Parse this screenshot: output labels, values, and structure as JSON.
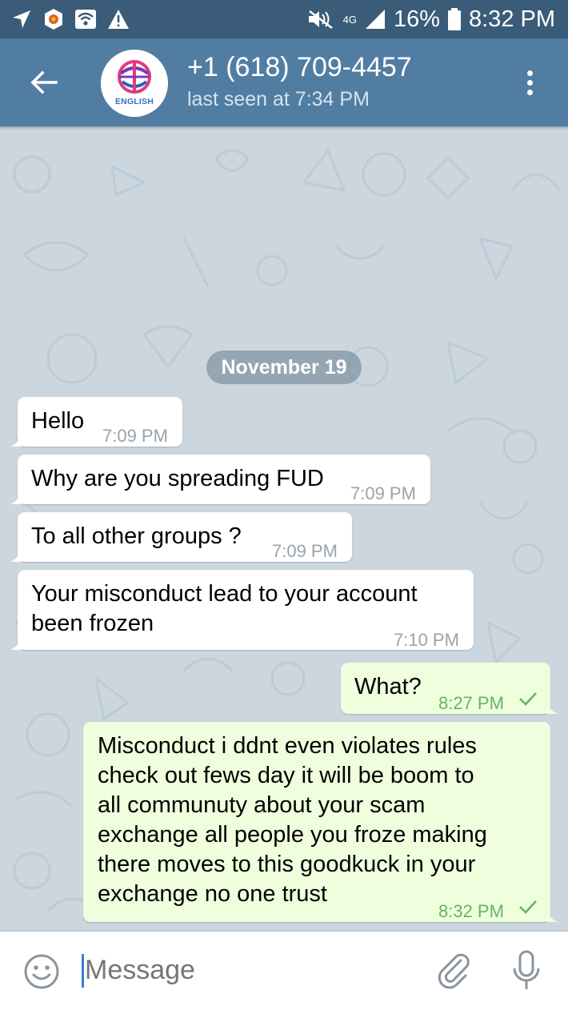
{
  "status_bar": {
    "network_label": "4G",
    "battery": "16%",
    "time": "8:32 PM"
  },
  "header": {
    "avatar_label": "ENGLISH",
    "title": "+1 (618) 709-4457",
    "subtitle": "last seen at 7:34 PM"
  },
  "chat": {
    "date": "November 19",
    "messages": [
      {
        "direction": "in",
        "text": "Hello",
        "time": "7:09 PM"
      },
      {
        "direction": "in",
        "text": "Why are you spreading FUD",
        "time": "7:09 PM"
      },
      {
        "direction": "in",
        "text": "To all other groups ?",
        "time": "7:09 PM"
      },
      {
        "direction": "in",
        "text": "Your misconduct lead to your account\nbeen frozen",
        "time": "7:10 PM"
      },
      {
        "direction": "out",
        "text": "What?",
        "time": "8:27 PM",
        "status": "sent"
      },
      {
        "direction": "out",
        "text": "Misconduct i ddnt even violates rules\ncheck out fews day it will be boom to\nall communuty about your scam\nexchange all  people you froze  making\nthere moves to this goodkuck in your\nexchange no one trust",
        "time": "8:32 PM",
        "status": "sent"
      }
    ]
  },
  "input": {
    "placeholder": "Message"
  },
  "colors": {
    "status_bar": "#3a5c78",
    "header": "#527da3",
    "chat_background": "#cbd6df",
    "incoming_bubble": "#ffffff",
    "outgoing_bubble": "#effedd",
    "outgoing_time": "#6bb260"
  },
  "icons": [
    "navigation-arrow-icon",
    "app-notification-icon",
    "wifi-icon",
    "warning-icon",
    "mute-icon",
    "signal-icon",
    "battery-icon",
    "back-arrow-icon",
    "more-menu-icon",
    "check-icon",
    "emoji-icon",
    "attach-icon",
    "microphone-icon"
  ]
}
